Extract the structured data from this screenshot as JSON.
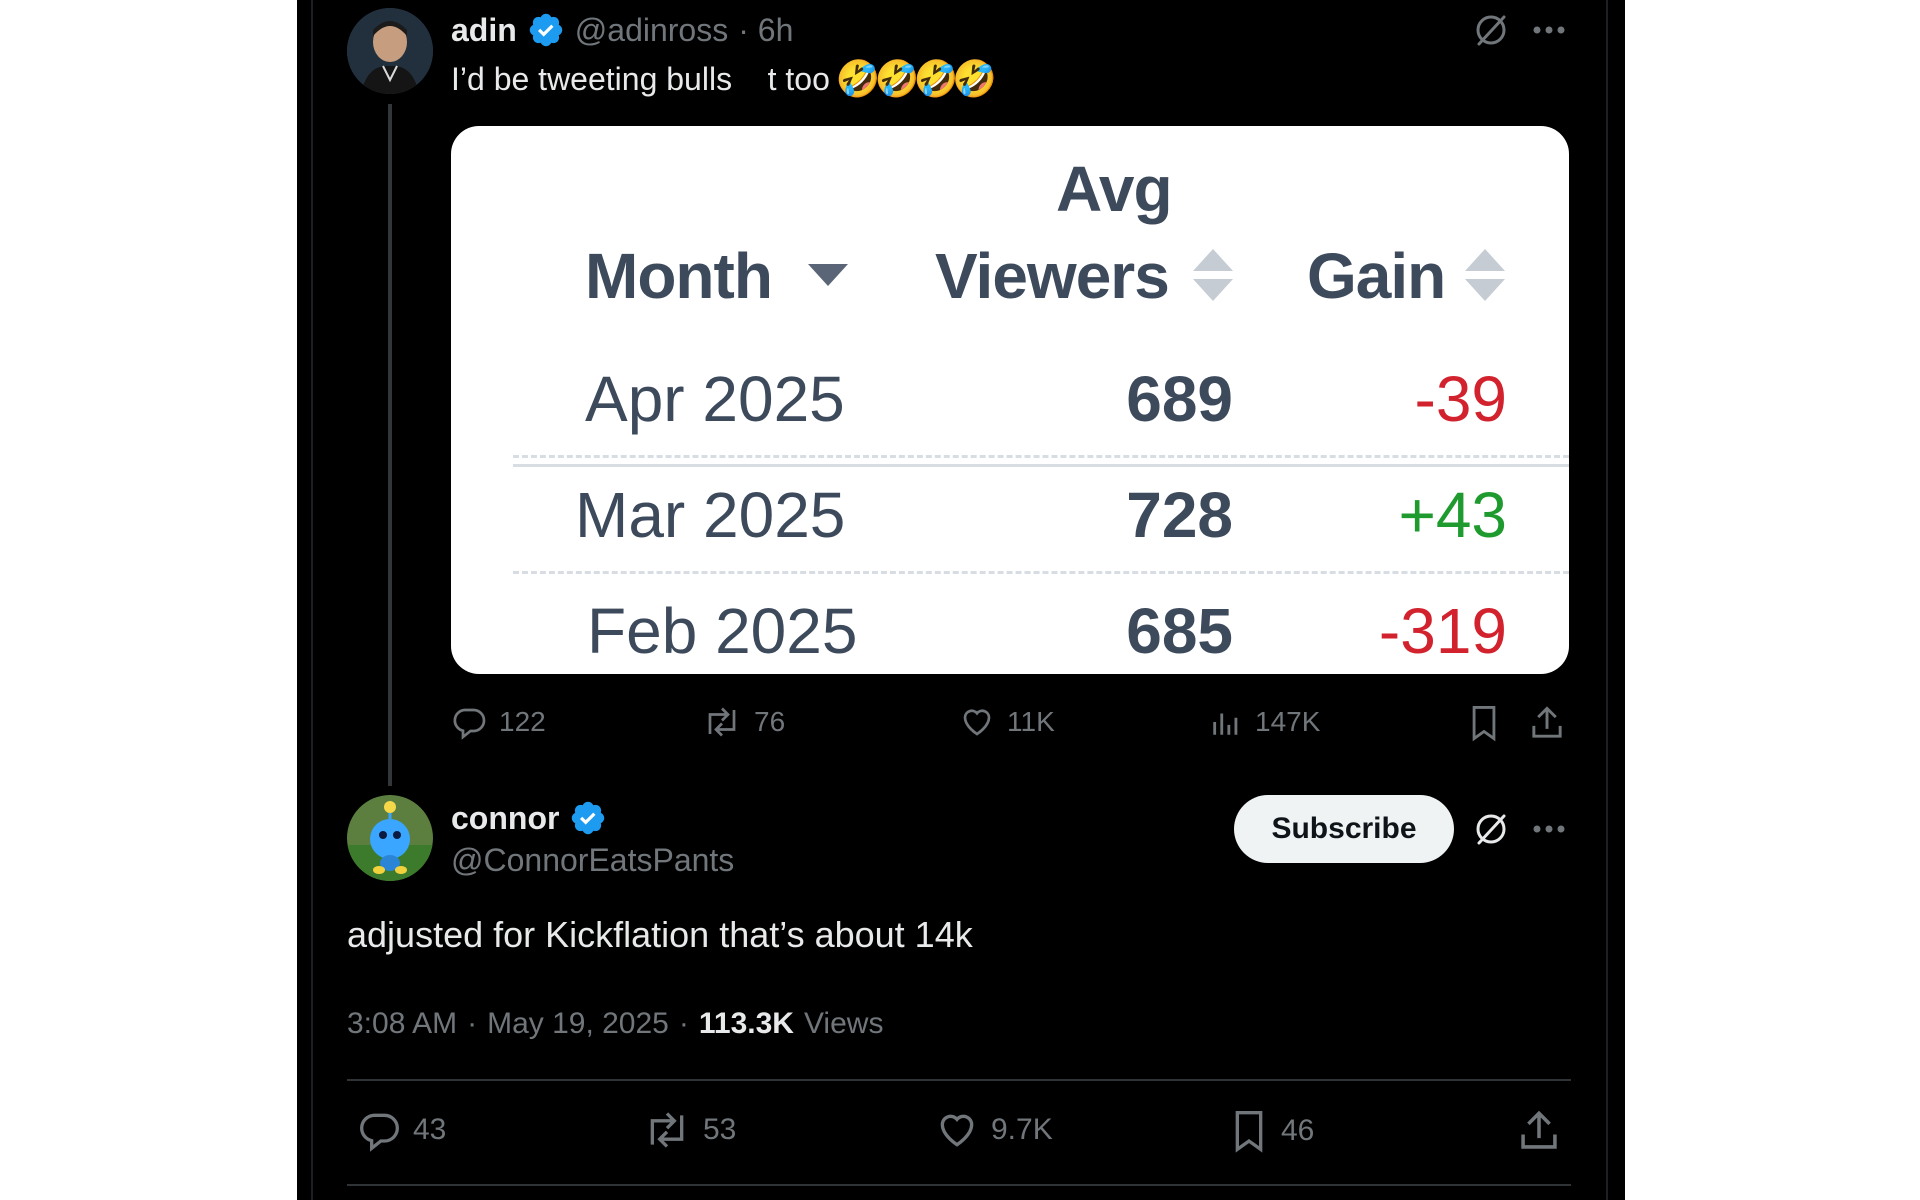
{
  "tweet1": {
    "author_name": "adin",
    "author_handle": "@adinross",
    "time": "· 6h",
    "text": "I’d be tweeting bulls    t too",
    "emojis": "🤣🤣🤣🤣",
    "table": {
      "headers": {
        "month": "Month",
        "avg": "Avg",
        "viewers": "Viewers",
        "gain": "Gain"
      },
      "rows": [
        {
          "month": "Apr 2025",
          "viewers": "689",
          "gain": "-39"
        },
        {
          "month": "Mar 2025",
          "viewers": "728",
          "gain": "+43"
        },
        {
          "month": "Feb 2025",
          "viewers": "685",
          "gain": "-319"
        }
      ]
    },
    "actions": {
      "replies": "122",
      "reposts": "76",
      "likes": "11K",
      "views": "147K"
    }
  },
  "tweet2": {
    "author_name": "connor",
    "author_handle": "@ConnorEatsPants",
    "subscribe_label": "Subscribe",
    "text": "adjusted for Kickflation that’s about 14k",
    "meta": {
      "time": "3:08 AM",
      "sep1": "·",
      "date": "May 19, 2025",
      "sep2": "·",
      "views": "113.3K",
      "views_label": "Views"
    },
    "actions": {
      "replies": "43",
      "reposts": "53",
      "likes": "9.7K",
      "bookmarks": "46"
    }
  },
  "colors": {
    "background": "#000000",
    "text": "#e7e9ea",
    "muted": "#71767b",
    "verified": "#1d9bf0",
    "gain_negative": "#d2222d",
    "gain_positive": "#1f9a2e",
    "table_text": "#3d4a5c"
  }
}
